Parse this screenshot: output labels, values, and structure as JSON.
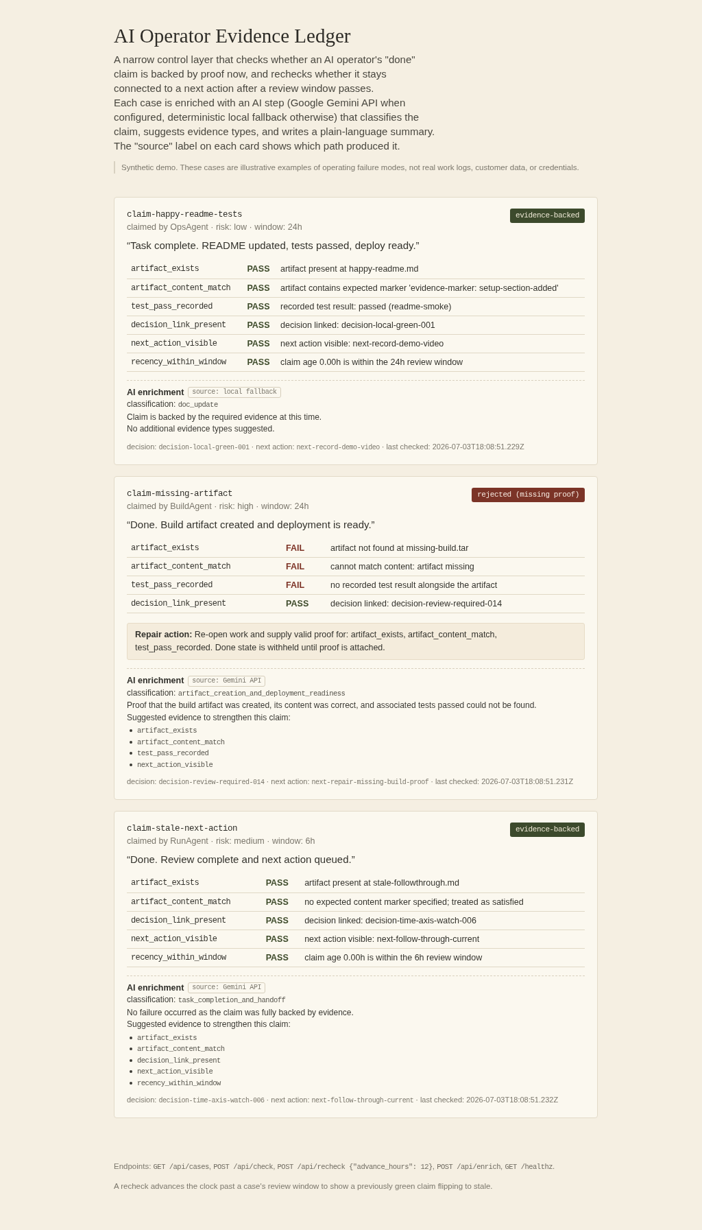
{
  "page": {
    "title": "AI Operator Evidence Ledger",
    "intro": [
      "A narrow control layer that checks whether an AI operator's \"done\" claim is backed by proof now, and rechecks whether it stays connected to a next action after a review window passes.",
      "Each case is enriched with an AI step (Google Gemini API when configured, deterministic local fallback otherwise) that classifies the claim, suggests evidence types, and writes a plain-language summary. The \"source\" label on each card shows which path produced it."
    ],
    "notice": "Synthetic demo. These cases are illustrative examples of operating failure modes, not real work logs, customer data, or credentials."
  },
  "cases": [
    {
      "id": "claim-happy-readme-tests",
      "meta": "claimed by OpsAgent · risk: low · window: 24h",
      "verdict": {
        "kind": "backed",
        "label": "evidence-backed"
      },
      "quote": "“Task complete. README updated, tests passed, deploy ready.”",
      "checks": [
        {
          "name": "artifact_exists",
          "status": "PASS",
          "passed": true,
          "detail": "artifact present at happy-readme.md"
        },
        {
          "name": "artifact_content_match",
          "status": "PASS",
          "passed": true,
          "detail": "artifact contains expected marker 'evidence-marker: setup-section-added'"
        },
        {
          "name": "test_pass_recorded",
          "status": "PASS",
          "passed": true,
          "detail": "recorded test result: passed (readme-smoke)"
        },
        {
          "name": "decision_link_present",
          "status": "PASS",
          "passed": true,
          "detail": "decision linked: decision-local-green-001"
        },
        {
          "name": "next_action_visible",
          "status": "PASS",
          "passed": true,
          "detail": "next action visible: next-record-demo-video"
        },
        {
          "name": "recency_within_window",
          "status": "PASS",
          "passed": true,
          "detail": "claim age 0.00h is within the 24h review window"
        }
      ],
      "enrichment": {
        "heading": "AI enrichment",
        "source": "source: local fallback",
        "classification": [
          {
            "kind": "text",
            "text": "classification: "
          },
          {
            "kind": "code",
            "text": "doc_update"
          }
        ],
        "summary": "Claim is backed by the required evidence at this time.",
        "suggestion_note": "No additional evidence types suggested."
      },
      "footer": [
        {
          "kind": "text",
          "text": "decision: "
        },
        {
          "kind": "code",
          "text": "decision-local-green-001"
        },
        {
          "kind": "text",
          "text": " · next action: "
        },
        {
          "kind": "code",
          "text": "next-record-demo-video"
        },
        {
          "kind": "text",
          "text": " · last checked: 2026-07-03T18:08:51.229Z"
        }
      ]
    },
    {
      "id": "claim-missing-artifact",
      "meta": "claimed by BuildAgent · risk: high · window: 24h",
      "verdict": {
        "kind": "rejected",
        "label": "rejected (missing proof)"
      },
      "quote": "“Done. Build artifact created and deployment is ready.”",
      "checks": [
        {
          "name": "artifact_exists",
          "status": "FAIL",
          "passed": false,
          "detail": "artifact not found at missing-build.tar"
        },
        {
          "name": "artifact_content_match",
          "status": "FAIL",
          "passed": false,
          "detail": "cannot match content: artifact missing"
        },
        {
          "name": "test_pass_recorded",
          "status": "FAIL",
          "passed": false,
          "detail": "no recorded test result alongside the artifact"
        },
        {
          "name": "decision_link_present",
          "status": "PASS",
          "passed": true,
          "detail": "decision linked: decision-review-required-014"
        }
      ],
      "repair": "**Repair action:** Re-open work and supply valid proof for: artifact_exists, artifact_content_match, test_pass_recorded. Done state is withheld until proof is attached.",
      "enrichment": {
        "heading": "AI enrichment",
        "source": "source: Gemini API",
        "classification": [
          {
            "kind": "text",
            "text": "classification: "
          },
          {
            "kind": "code",
            "text": "artifact_creation_and_deployment_readiness"
          }
        ],
        "summary": "Proof that the build artifact was created, its content was correct, and associated tests passed could not be found.",
        "suggestion_note": "Suggested evidence to strengthen this claim:",
        "suggestions": [
          "artifact_exists",
          "artifact_content_match",
          "test_pass_recorded",
          "next_action_visible"
        ]
      },
      "footer": [
        {
          "kind": "text",
          "text": "decision: "
        },
        {
          "kind": "code",
          "text": "decision-review-required-014"
        },
        {
          "kind": "text",
          "text": " · next action: "
        },
        {
          "kind": "code",
          "text": "next-repair-missing-build-proof"
        },
        {
          "kind": "text",
          "text": " · last checked: 2026-07-03T18:08:51.231Z"
        }
      ]
    },
    {
      "id": "claim-stale-next-action",
      "meta": "claimed by RunAgent · risk: medium · window: 6h",
      "verdict": {
        "kind": "backed",
        "label": "evidence-backed"
      },
      "quote": "“Done. Review complete and next action queued.”",
      "checks": [
        {
          "name": "artifact_exists",
          "status": "PASS",
          "passed": true,
          "detail": "artifact present at stale-followthrough.md"
        },
        {
          "name": "artifact_content_match",
          "status": "PASS",
          "passed": true,
          "detail": "no expected content marker specified; treated as satisfied"
        },
        {
          "name": "decision_link_present",
          "status": "PASS",
          "passed": true,
          "detail": "decision linked: decision-time-axis-watch-006"
        },
        {
          "name": "next_action_visible",
          "status": "PASS",
          "passed": true,
          "detail": "next action visible: next-follow-through-current"
        },
        {
          "name": "recency_within_window",
          "status": "PASS",
          "passed": true,
          "detail": "claim age 0.00h is within the 6h review window"
        }
      ],
      "enrichment": {
        "heading": "AI enrichment",
        "source": "source: Gemini API",
        "classification": [
          {
            "kind": "text",
            "text": "classification: "
          },
          {
            "kind": "code",
            "text": "task_completion_and_handoff"
          }
        ],
        "summary": "No failure occurred as the claim was fully backed by evidence.",
        "suggestion_note": "Suggested evidence to strengthen this claim:",
        "suggestions": [
          "artifact_exists",
          "artifact_content_match",
          "decision_link_present",
          "next_action_visible",
          "recency_within_window"
        ]
      },
      "footer": [
        {
          "kind": "text",
          "text": "decision: "
        },
        {
          "kind": "code",
          "text": "decision-time-axis-watch-006"
        },
        {
          "kind": "text",
          "text": " · next action: "
        },
        {
          "kind": "code",
          "text": "next-follow-through-current"
        },
        {
          "kind": "text",
          "text": " · last checked: 2026-07-03T18:08:51.232Z"
        }
      ]
    }
  ],
  "footer": {
    "endpoints": [
      {
        "kind": "text",
        "text": "Endpoints: "
      },
      {
        "kind": "code",
        "text": "GET /api/cases"
      },
      {
        "kind": "text",
        "text": ", "
      },
      {
        "kind": "code",
        "text": "POST /api/check"
      },
      {
        "kind": "text",
        "text": ", "
      },
      {
        "kind": "code",
        "text": "POST /api/recheck {\"advance_hours\": 12}"
      },
      {
        "kind": "text",
        "text": ", "
      },
      {
        "kind": "code",
        "text": "POST /api/enrich"
      },
      {
        "kind": "text",
        "text": ", "
      },
      {
        "kind": "code",
        "text": "GET /healthz"
      },
      {
        "kind": "text",
        "text": "."
      }
    ],
    "note": "A recheck advances the clock past a case's review window to show a previously green claim flipping to stale."
  }
}
